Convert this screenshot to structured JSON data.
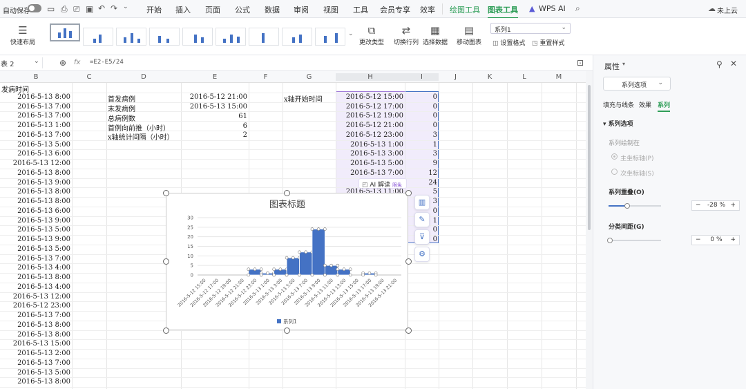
{
  "topbar": {
    "autosave_label": "自动保存",
    "menus": [
      "开始",
      "插入",
      "页面",
      "公式",
      "数据",
      "审阅",
      "视图",
      "工具",
      "会员专享",
      "效率"
    ],
    "context_tabs": [
      "绘图工具",
      "图表工具"
    ],
    "wps_ai": "WPS AI",
    "cloud_status": "未上云"
  },
  "ribbon": {
    "quick_layout": "快速布局",
    "change_type": "更改类型",
    "switch_rowcol": "切换行列",
    "select_data": "选择数据",
    "move_chart": "移动图表",
    "series_select": "系列1",
    "set_format": "设置格式",
    "reset_style": "重置样式"
  },
  "formula_bar": {
    "name_box": "表 2",
    "fx": "fx",
    "formula": "=E2-E5/24"
  },
  "columns": [
    "B",
    "C",
    "D",
    "E",
    "F",
    "G",
    "H",
    "I",
    "J",
    "K",
    "L",
    "M"
  ],
  "sheet": {
    "b_header": "发病时间",
    "b_values": [
      "2016-5-13 8:00",
      "2016-5-13 7:00",
      "2016-5-13 7:00",
      "2016-5-13 1:00",
      "2016-5-13 7:00",
      "2016-5-13 5:00",
      "2016-5-13 6:00",
      "2016-5-13 12:00",
      "2016-5-13 8:00",
      "2016-5-13 9:00",
      "2016-5-13 8:00",
      "2016-5-13 8:00",
      "2016-5-13 6:00",
      "2016-5-13 9:00",
      "2016-5-13 5:00",
      "2016-5-13 9:00",
      "2016-5-13 5:00",
      "2016-5-13 7:00",
      "2016-5-13 4:00",
      "2016-5-13 8:00",
      "2016-5-13 4:00",
      "2016-5-13 12:00",
      "2016-5-12 23:00",
      "2016-5-13 7:00",
      "2016-5-13 8:00",
      "2016-5-13 8:00",
      "2016-5-13 15:00",
      "2016-5-13 2:00",
      "2016-5-13 7:00",
      "2016-5-13 5:00",
      "2016-5-13 8:00"
    ],
    "d_labels": [
      "首发病例",
      "末发病例",
      "总病例数",
      "首例向前推（小时）",
      "x轴统计间隔（小时）"
    ],
    "e_values": [
      "2016-5-12 21:00",
      "2016-5-13 15:00",
      "61",
      "6",
      "2"
    ],
    "g_label": "x轴开始时间",
    "h_values": [
      "2016-5-12 15:00",
      "2016-5-12 17:00",
      "2016-5-12 19:00",
      "2016-5-12 21:00",
      "2016-5-12 23:00",
      "2016-5-13 1:00",
      "2016-5-13 3:00",
      "2016-5-13 5:00",
      "2016-5-13 7:00",
      "20",
      "2016-5-13 11:00"
    ],
    "i_values": [
      "0",
      "0",
      "0",
      "0",
      "3",
      "1",
      "3",
      "9",
      "12",
      "24",
      "5",
      "3",
      "0",
      "1",
      "0",
      "0"
    ],
    "ai_tip": "AI 解读",
    "ai_badge": "限免"
  },
  "chart_data": {
    "type": "bar",
    "title": "图表标题",
    "categories": [
      "2016-5-12 15:00",
      "2016-5-12 17:00",
      "2016-5-12 19:00",
      "2016-5-12 21:00",
      "2016-5-12 23:00",
      "2016-5-13 1:00",
      "2016-5-13 3:00",
      "2016-5-13 5:00",
      "2016-5-13 7:00",
      "2016-5-13 9:00",
      "2016-5-13 11:00",
      "2016-5-13 13:00",
      "2016-5-13 15:00",
      "2016-5-13 17:00",
      "2016-5-13 19:00",
      "2016-5-13 21:00"
    ],
    "series": [
      {
        "name": "系列1",
        "values": [
          0,
          0,
          0,
          0,
          3,
          1,
          3,
          9,
          12,
          24,
          5,
          3,
          0,
          1,
          0,
          0
        ]
      }
    ],
    "ylim": [
      0,
      30
    ],
    "yticks": [
      "0",
      "5",
      "10",
      "15",
      "20",
      "25",
      "30"
    ],
    "legend_position": "bottom",
    "color": "#4472c4"
  },
  "panel": {
    "title": "属性",
    "dropdown": "系列选项",
    "tabs": [
      "填充与线条",
      "效果",
      "系列"
    ],
    "section": "系列选项",
    "plot_on": "系列绘制在",
    "primary_axis": "主坐标轴(P)",
    "secondary_axis": "次坐标轴(S)",
    "overlap_label": "系列重叠(O)",
    "overlap_value": "-28 %",
    "gap_label": "分类间距(G)",
    "gap_value": "0 %",
    "overlap_fraction": 0.36,
    "gap_fraction": 0.0
  }
}
